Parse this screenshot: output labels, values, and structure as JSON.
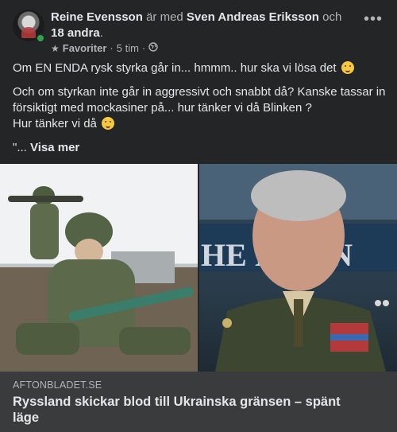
{
  "post": {
    "author": "Reine Evensson",
    "with_text": "är med",
    "tagged": "Sven Andreas Eriksson",
    "and_text": "och",
    "others": "18 andra",
    "period": ".",
    "audience": "Favoriter",
    "time": "5 tim",
    "dot": "·",
    "lines": [
      "Om EN ENDA rysk styrka går in... hmmm.. hur ska vi lösa det",
      "Och om styrkan inte går in aggressivt och snabbt då? Kanske tassar in försiktigt med mockasiner på... hur tänker vi då Blinken ?",
      "Hur tänker vi då"
    ],
    "quote_prefix": "\"...",
    "see_more": "Visa mer"
  },
  "link": {
    "domain": "AFTONBLADET.SE",
    "headline": "Ryssland skickar blod till Ukrainska gränsen – spänt läge"
  },
  "images": {
    "right_sign_text": "HE P GON"
  }
}
